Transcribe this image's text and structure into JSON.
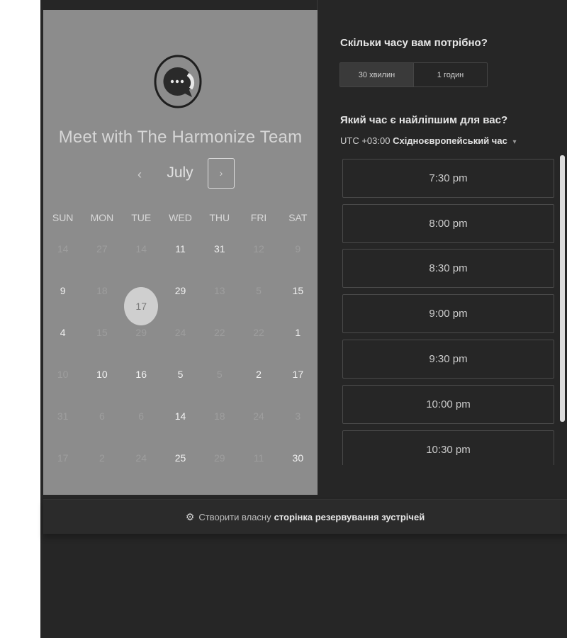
{
  "booking": {
    "title": "Meet with The Harmonize Team",
    "month": "July",
    "prev_symbol": "‹",
    "next_symbol": "›",
    "weekdays": [
      "SUN",
      "MON",
      "TUE",
      "WED",
      "THU",
      "FRI",
      "SAT"
    ],
    "weeks": [
      [
        {
          "d": "14",
          "a": false
        },
        {
          "d": "27",
          "a": false
        },
        {
          "d": "14",
          "a": false
        },
        {
          "d": "11",
          "a": true
        },
        {
          "d": "31",
          "a": true
        },
        {
          "d": "12",
          "a": false
        },
        {
          "d": "9",
          "a": false
        }
      ],
      [
        {
          "d": "9",
          "a": true
        },
        {
          "d": "18",
          "a": false
        },
        {
          "d": "17",
          "a": true,
          "selected": true
        },
        {
          "d": "29",
          "a": true
        },
        {
          "d": "13",
          "a": false
        },
        {
          "d": "5",
          "a": false
        },
        {
          "d": "15",
          "a": true
        }
      ],
      [
        {
          "d": "4",
          "a": true
        },
        {
          "d": "15",
          "a": false
        },
        {
          "d": "29",
          "a": false
        },
        {
          "d": "24",
          "a": false
        },
        {
          "d": "22",
          "a": false
        },
        {
          "d": "22",
          "a": false
        },
        {
          "d": "1",
          "a": true
        }
      ],
      [
        {
          "d": "10",
          "a": false
        },
        {
          "d": "10",
          "a": true
        },
        {
          "d": "16",
          "a": true
        },
        {
          "d": "5",
          "a": true
        },
        {
          "d": "5",
          "a": false
        },
        {
          "d": "2",
          "a": true
        },
        {
          "d": "17",
          "a": true
        }
      ],
      [
        {
          "d": "31",
          "a": false
        },
        {
          "d": "6",
          "a": false
        },
        {
          "d": "6",
          "a": false
        },
        {
          "d": "14",
          "a": true
        },
        {
          "d": "18",
          "a": false
        },
        {
          "d": "24",
          "a": false
        },
        {
          "d": "3",
          "a": false
        }
      ],
      [
        {
          "d": "17",
          "a": false
        },
        {
          "d": "2",
          "a": false
        },
        {
          "d": "24",
          "a": false
        },
        {
          "d": "25",
          "a": true
        },
        {
          "d": "29",
          "a": false
        },
        {
          "d": "11",
          "a": false
        },
        {
          "d": "30",
          "a": true
        }
      ]
    ]
  },
  "duration": {
    "title": "Скільки часу вам потрібно?",
    "options": [
      "30 хвилин",
      "1 годин"
    ],
    "selected": "30 хвилин"
  },
  "time": {
    "title": "Який час є найліпшим для вас?",
    "timezone_offset": "UTC +03:00",
    "timezone_name": "Східноєвропейський час",
    "slots": [
      "7:30 pm",
      "8:00 pm",
      "8:30 pm",
      "9:00 pm",
      "9:30 pm",
      "10:00 pm",
      "10:30 pm"
    ]
  },
  "footer": {
    "prefix": "Створити власну",
    "link": "сторінка резервування зустрічей"
  }
}
